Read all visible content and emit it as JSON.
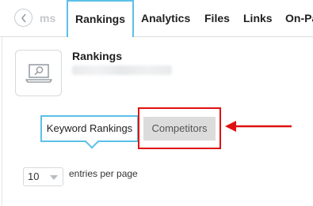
{
  "tabs": [
    {
      "label": "ms"
    },
    {
      "label": "Rankings"
    },
    {
      "label": "Analytics"
    },
    {
      "label": "Files"
    },
    {
      "label": "Links"
    },
    {
      "label": "On-Pa"
    }
  ],
  "header": {
    "title": "Rankings",
    "icon": "laptop-search-icon"
  },
  "subtabs": {
    "keyword_rankings": "Keyword Rankings",
    "competitors": "Competitors"
  },
  "annotation": {
    "color": "#e01010"
  },
  "accent_color": "#5bc0e8",
  "entries": {
    "value": "10",
    "label": "entries per page"
  }
}
